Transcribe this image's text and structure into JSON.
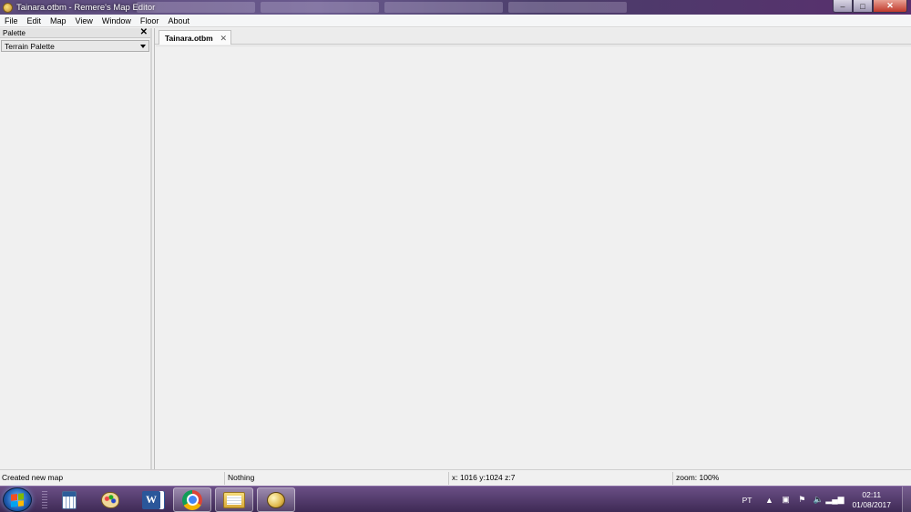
{
  "window": {
    "title": "Tainara.otbm - Remere's Map Editor",
    "buttons": {
      "minimize": "–",
      "maximize": "□",
      "close": "✕"
    }
  },
  "menu": [
    "File",
    "Edit",
    "Map",
    "View",
    "Window",
    "Floor",
    "About"
  ],
  "palette": {
    "header": "Palette",
    "close": "✕",
    "selected": "Terrain Palette"
  },
  "editor": {
    "tab_label": "Tainara.otbm",
    "tab_close": "✕"
  },
  "status": {
    "message": "Created new map",
    "selection": "Nothing",
    "coords": "x: 1016 y:1024 z:7",
    "zoom": "zoom: 100%"
  },
  "taskbar": {
    "apps": [
      "calculator-icon",
      "paint-icon",
      "word-icon",
      "chrome-icon",
      "file-explorer-icon",
      "map-editor-icon"
    ],
    "tray": {
      "language": "PT",
      "time": "02:11",
      "date": "01/08/2017"
    }
  },
  "colors": {
    "taskbar": "#4e3868",
    "word": "#2b579a",
    "close_button": "#c0392b"
  }
}
